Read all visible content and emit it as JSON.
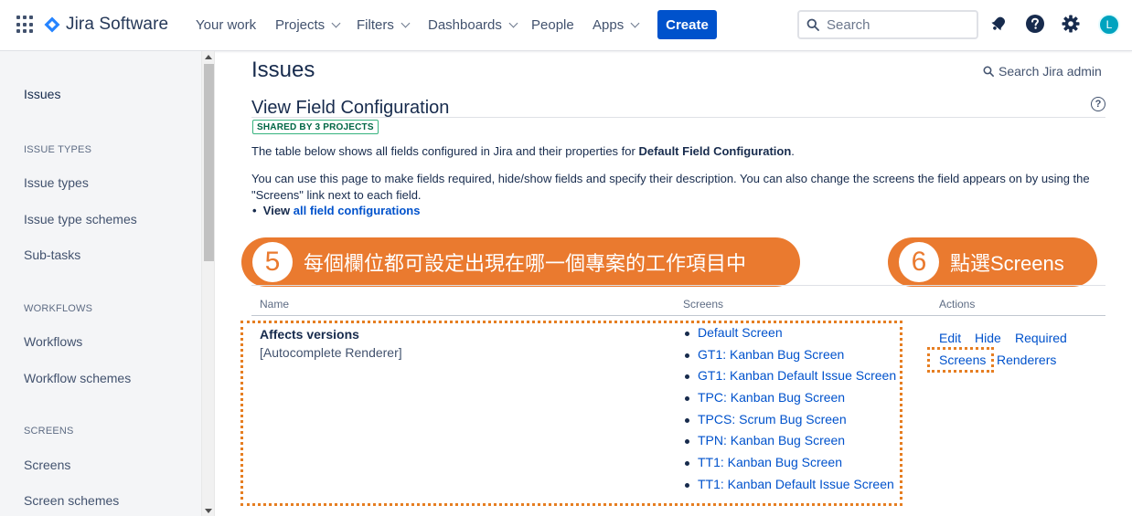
{
  "nav": {
    "product": "Jira Software",
    "items": [
      {
        "label": "Your work",
        "dropdown": false
      },
      {
        "label": "Projects",
        "dropdown": true
      },
      {
        "label": "Filters",
        "dropdown": true
      },
      {
        "label": "Dashboards",
        "dropdown": true
      },
      {
        "label": "People",
        "dropdown": false
      },
      {
        "label": "Apps",
        "dropdown": true
      }
    ],
    "create_label": "Create",
    "search_placeholder": "Search",
    "avatar_initial": "L",
    "brand_color": "#0052cc"
  },
  "sidebar": {
    "top_item": "Issues",
    "sections": [
      {
        "heading": "ISSUE TYPES",
        "items": [
          "Issue types",
          "Issue type schemes",
          "Sub-tasks"
        ]
      },
      {
        "heading": "WORKFLOWS",
        "items": [
          "Workflows",
          "Workflow schemes"
        ]
      },
      {
        "heading": "SCREENS",
        "items": [
          "Screens",
          "Screen schemes"
        ]
      }
    ]
  },
  "main": {
    "page_title": "Issues",
    "admin_search": "Search Jira admin",
    "section_title": "View Field Configuration",
    "shared_badge": "SHARED BY 3 PROJECTS",
    "intro_prefix": "The table below shows all fields configured in Jira and their properties for ",
    "intro_bold": "Default Field Configuration",
    "intro_suffix": ".",
    "description_line1": "You can use this page to make fields required, hide/show fields and specify their description. You can also change the screens the field appears on by using the",
    "description_line2": "\"Screens\" link next to each field.",
    "view_prefix": "View ",
    "view_link": "all field configurations"
  },
  "callouts": [
    {
      "number": "5",
      "text": "每個欄位都可設定出現在哪一個專案的工作項目中"
    },
    {
      "number": "6",
      "text": "點選Screens"
    }
  ],
  "table": {
    "headers": {
      "name": "Name",
      "screens": "Screens",
      "actions": "Actions"
    },
    "row": {
      "field_name": "Affects versions",
      "renderer": "[Autocomplete Renderer]",
      "screens": [
        "Default Screen",
        "GT1: Kanban Bug Screen",
        "GT1: Kanban Default Issue Screen",
        "TPC: Kanban Bug Screen",
        "TPCS: Scrum Bug Screen",
        "TPN: Kanban Bug Screen",
        "TT1: Kanban Bug Screen",
        "TT1: Kanban Default Issue Screen"
      ],
      "actions": {
        "edit": "Edit",
        "hide": "Hide",
        "required": "Required",
        "screens": "Screens",
        "renderers": "Renderers"
      }
    }
  },
  "colors": {
    "callout": "#ea7a2f",
    "link": "#0052cc",
    "badge_green": "#36b37e"
  }
}
